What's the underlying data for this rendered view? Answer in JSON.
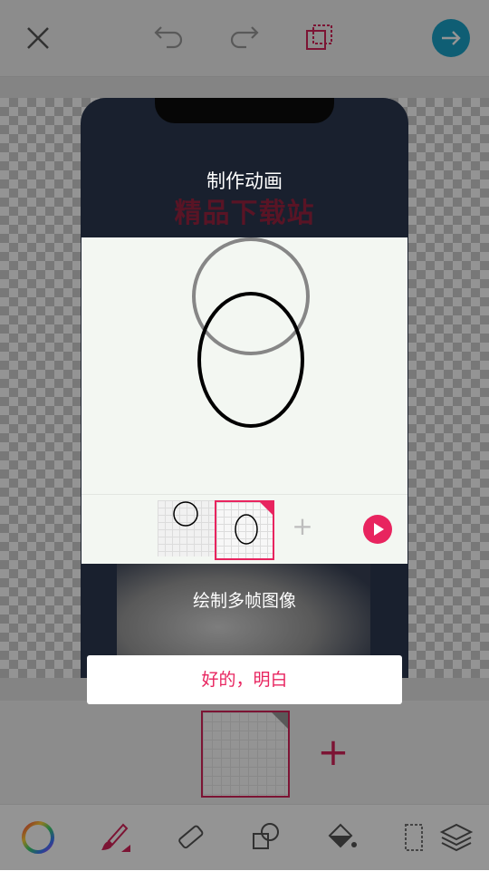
{
  "icons": {
    "close": "close-icon",
    "undo": "undo-icon",
    "redo": "redo-icon",
    "layer_select": "layer-select-icon",
    "next": "arrow-right-icon",
    "color_wheel": "color-wheel-icon",
    "brush": "brush-icon",
    "eraser": "eraser-icon",
    "shapes": "shapes-icon",
    "fill": "paint-bucket-icon",
    "selection": "selection-icon",
    "layers": "layers-icon",
    "add_frame": "plus-icon",
    "play": "play-icon"
  },
  "colors": {
    "accent": "#e8245f",
    "next_button": "#1aa3c9",
    "overlay": "rgba(0,0,0,0.42)"
  },
  "phone_preview": {
    "watermark": "精品下载站"
  },
  "framestrip": {
    "add_symbol": "+"
  },
  "tutorial": {
    "title": "制作动画",
    "caption": "绘制多帧图像",
    "timeline_plus": "+",
    "ok_button": "好的，明白"
  }
}
